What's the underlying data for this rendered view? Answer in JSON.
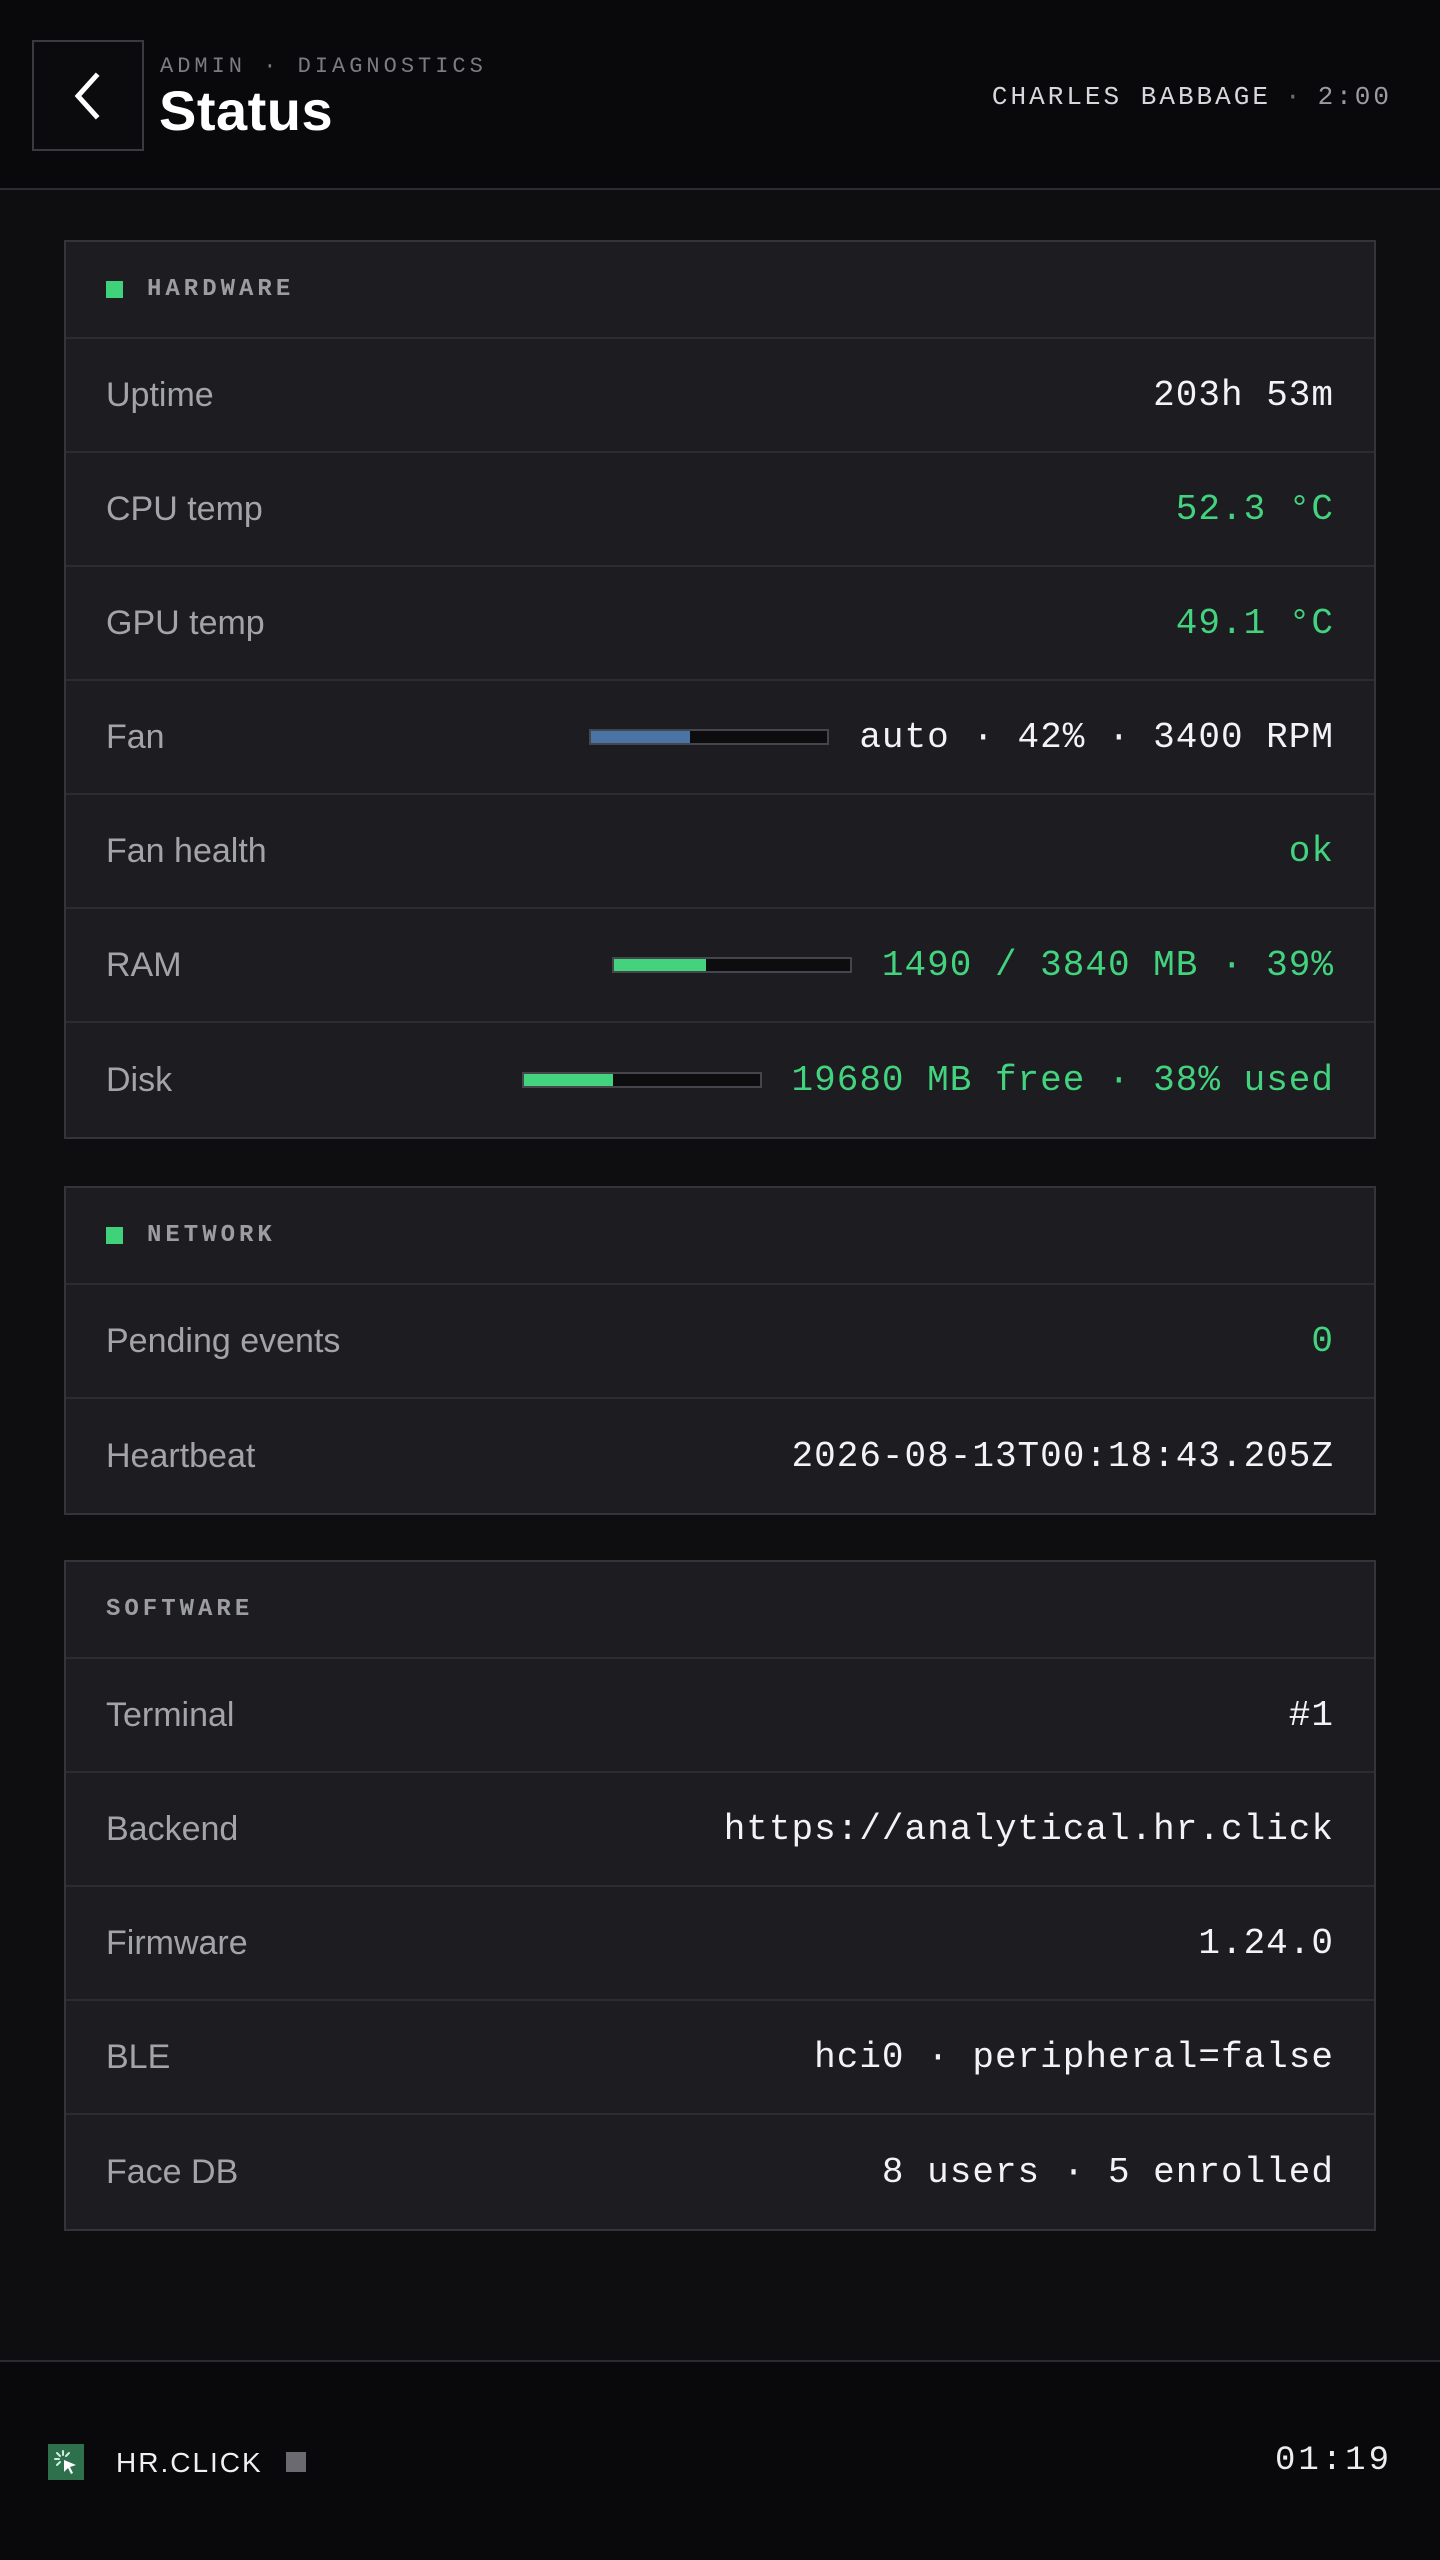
{
  "header": {
    "breadcrumb": "ADMIN · DIAGNOSTICS",
    "title": "Status",
    "user": "CHARLES BABBAGE",
    "separator": "·",
    "time": "2:00"
  },
  "hardware": {
    "title": "HARDWARE",
    "rows": [
      {
        "label": "Uptime",
        "value": "203h 53m"
      },
      {
        "label": "CPU temp",
        "value": "52.3 °C"
      },
      {
        "label": "GPU temp",
        "value": "49.1 °C"
      },
      {
        "label": "Fan",
        "value": "auto · 42% · 3400 RPM",
        "fraction": 0.42
      },
      {
        "label": "Fan health",
        "value": "ok"
      },
      {
        "label": "RAM",
        "value": "1490 / 3840 MB · 39%",
        "fraction": 0.39
      },
      {
        "label": "Disk",
        "value": "19680 MB free · 38% used",
        "fraction": 0.38
      }
    ]
  },
  "network": {
    "title": "NETWORK",
    "rows": [
      {
        "label": "Pending events",
        "value": "0"
      },
      {
        "label": "Heartbeat",
        "value": "2026-08-13T00:18:43.205Z"
      }
    ]
  },
  "software": {
    "title": "SOFTWARE",
    "rows": [
      {
        "label": "Terminal",
        "value": "#1"
      },
      {
        "label": "Backend",
        "value": "https://analytical.hr.click"
      },
      {
        "label": "Firmware",
        "value": "1.24.0"
      },
      {
        "label": "BLE",
        "value": "hci0 · peripheral=false"
      },
      {
        "label": "Face DB",
        "value": "8 users · 5 enrolled"
      }
    ]
  },
  "footer": {
    "brand": "HR.CLICK",
    "time": "01:19"
  },
  "colors": {
    "accent_green": "#43d37e",
    "fan_bar": "#4a74a6",
    "background": "#0e0e11",
    "panel": "#1c1c21"
  },
  "icons": {
    "back": "chevron-left-icon",
    "status_dot": "status-dot-icon",
    "brand": "hr-click-logo-icon"
  }
}
